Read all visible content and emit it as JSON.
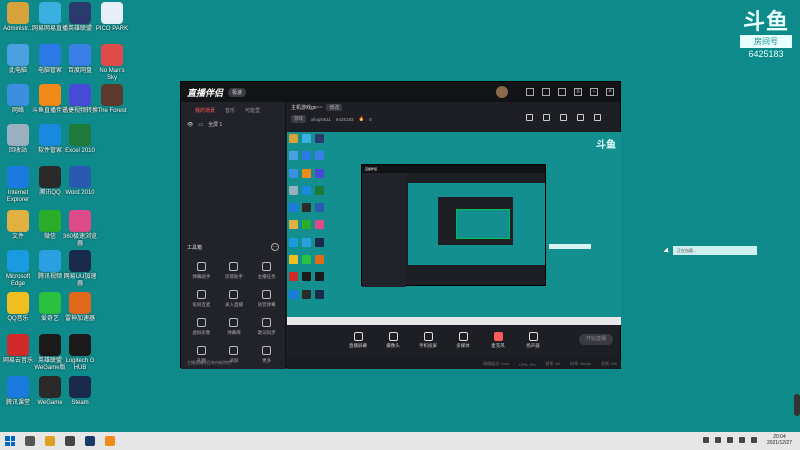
{
  "desktop": {
    "icons": [
      {
        "label": "Administr...",
        "color": "#d7a23a"
      },
      {
        "label": "网易网易直播",
        "color": "#3ab0e0"
      },
      {
        "label": "英雄联盟",
        "color": "#2b3a6e"
      },
      {
        "label": "PICO PARK",
        "color": "#e8eef8"
      },
      {
        "label": "此电脑",
        "color": "#4aa0e0"
      },
      {
        "label": "电脑管家",
        "color": "#2a7be8"
      },
      {
        "label": "百度网盘",
        "color": "#3a7fe8"
      },
      {
        "label": "No Man's Sky",
        "color": "#e04a4a"
      },
      {
        "label": "网络",
        "color": "#3a8fe0"
      },
      {
        "label": "斗鱼直播伴侣",
        "color": "#f28a1a"
      },
      {
        "label": "迅捷视频转换",
        "color": "#4a4ad8"
      },
      {
        "label": "The Forest",
        "color": "#5a3a2a"
      },
      {
        "label": "回收站",
        "color": "#9ab0c0"
      },
      {
        "label": "软件管家",
        "color": "#1a8ae0"
      },
      {
        "label": "Excel 2010",
        "color": "#1e7a3a"
      },
      {
        "label": "",
        "color": "#0f8a8a"
      },
      {
        "label": "Internet Explorer",
        "color": "#1a7ae0"
      },
      {
        "label": "腾讯QQ",
        "color": "#2a2a2a"
      },
      {
        "label": "Word 2010",
        "color": "#2a5ab0"
      },
      {
        "label": "",
        "color": "#0f8a8a"
      },
      {
        "label": "文件",
        "color": "#e0b040"
      },
      {
        "label": "微信",
        "color": "#2aae2a"
      },
      {
        "label": "360极速浏览器",
        "color": "#e04a8a"
      },
      {
        "label": "",
        "color": "#0f8a8a"
      },
      {
        "label": "Microsoft Edge",
        "color": "#1a9ae0"
      },
      {
        "label": "腾讯视频",
        "color": "#2aa0e0"
      },
      {
        "label": "网易UU加速器",
        "color": "#1a2a4a"
      },
      {
        "label": "",
        "color": "#0f8a8a"
      },
      {
        "label": "QQ音乐",
        "color": "#f0c020"
      },
      {
        "label": "爱奇艺",
        "color": "#2ac040"
      },
      {
        "label": "雷神加速器",
        "color": "#e06a1a"
      },
      {
        "label": "",
        "color": "#0f8a8a"
      },
      {
        "label": "网易云音乐",
        "color": "#d02a2a"
      },
      {
        "label": "英雄联盟 WeGame版",
        "color": "#1a1a1a"
      },
      {
        "label": "Logitech G HUB",
        "color": "#1a1a1a"
      },
      {
        "label": "",
        "color": "#0f8a8a"
      },
      {
        "label": "腾讯课堂",
        "color": "#1a7ae0"
      },
      {
        "label": "WeGame",
        "color": "#2a2a2a"
      },
      {
        "label": "Steam",
        "color": "#1a2a4a"
      }
    ]
  },
  "watermark": {
    "logo": "斗鱼",
    "room_label": "房间号",
    "room_number": "6425183"
  },
  "app": {
    "title": "直播伴侣",
    "version_badge": "极速",
    "left_tabs": [
      "我的场景",
      "音乐",
      "可能里"
    ],
    "scene_name": "全屏 1",
    "tools_title": "工具箱",
    "tools_more": "···",
    "tools": [
      {
        "label": "弹幕助手"
      },
      {
        "label": "房管助手"
      },
      {
        "label": "主播任务"
      },
      {
        "label": "投屏连麦"
      },
      {
        "label": "录入直播"
      },
      {
        "label": "语音弹幕"
      },
      {
        "label": "虚拟形象"
      },
      {
        "label": "弹幕库"
      },
      {
        "label": "歌词同步"
      },
      {
        "label": "礼物"
      },
      {
        "label": "录屏"
      },
      {
        "label": "更多"
      }
    ],
    "footer_text": "主播直播伴侣有何新特性",
    "room_title": "主机游戏go~~",
    "room_title_tag": "修改",
    "category_pill": "游戏",
    "username": "xihuji0611",
    "room_id": "6425183",
    "viewers": "0",
    "controls": [
      {
        "label": "直播屏幕"
      },
      {
        "label": "摄像头"
      },
      {
        "label": "手机投屏"
      },
      {
        "label": "多媒体"
      },
      {
        "label": "麦克风",
        "accent": true
      },
      {
        "label": "扬声器"
      }
    ],
    "start_button": "开始直播",
    "status": [
      "网络延迟: 0ms",
      "CPU: 5%",
      "帧率: 60",
      "码率: 0kbps",
      "丢帧: 0%"
    ],
    "preview_overlay": "正在加载..."
  },
  "taskbar": {
    "time": "20:04",
    "date": "2021/12/27",
    "apps": [
      {
        "name": "task-view-icon",
        "color": "#555555"
      },
      {
        "name": "chrome-icon",
        "color": "#e0a020"
      },
      {
        "name": "game-icon",
        "color": "#444444"
      },
      {
        "name": "steam-icon",
        "color": "#1a3a6a"
      },
      {
        "name": "douyu-icon",
        "color": "#f28a1a"
      }
    ]
  }
}
